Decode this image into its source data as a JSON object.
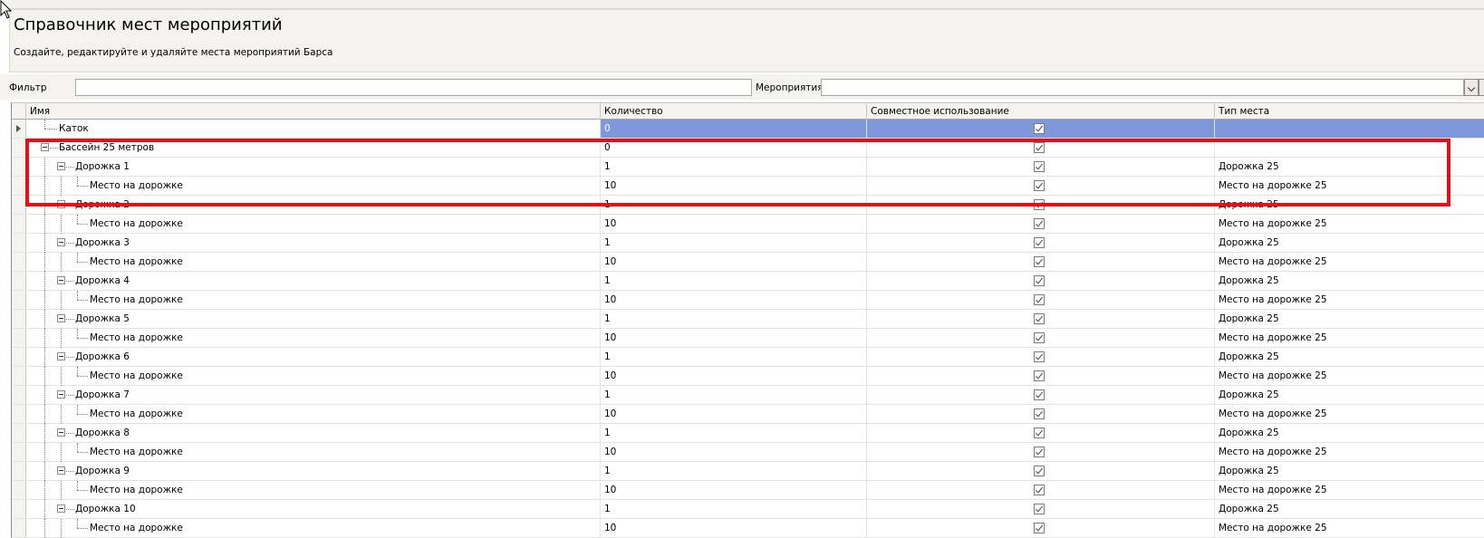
{
  "header": {
    "title": "Справочник мест мероприятий",
    "subtitle": "Создайте, редактируйте и удаляйте места мероприятий Барса"
  },
  "filters": {
    "filter_label": "Фильтр",
    "filter_value": "",
    "events_label": "Мероприятия",
    "events_value": ""
  },
  "grid": {
    "columns": [
      "Имя",
      "Количество",
      "Совместное использование",
      "Тип места"
    ],
    "rows": [
      {
        "name": "Каток",
        "level": 0,
        "expander": false,
        "qty": "0",
        "shared": true,
        "type": "",
        "selected": true
      },
      {
        "name": "Бассейн 25 метров",
        "level": 0,
        "expander": true,
        "qty": "0",
        "shared": true,
        "type": "",
        "selected": false
      },
      {
        "name": "Дорожка 1",
        "level": 1,
        "expander": true,
        "qty": "1",
        "shared": true,
        "type": "Дорожка 25",
        "selected": false
      },
      {
        "name": "Место на дорожке",
        "level": 2,
        "expander": false,
        "qty": "10",
        "shared": true,
        "type": "Место на дорожке 25",
        "selected": false
      },
      {
        "name": "Дорожка 2",
        "level": 1,
        "expander": true,
        "qty": "1",
        "shared": true,
        "type": "Дорожка 25",
        "selected": false
      },
      {
        "name": "Место на дорожке",
        "level": 2,
        "expander": false,
        "qty": "10",
        "shared": true,
        "type": "Место на дорожке 25",
        "selected": false
      },
      {
        "name": "Дорожка 3",
        "level": 1,
        "expander": true,
        "qty": "1",
        "shared": true,
        "type": "Дорожка 25",
        "selected": false
      },
      {
        "name": "Место на дорожке",
        "level": 2,
        "expander": false,
        "qty": "10",
        "shared": true,
        "type": "Место на дорожке 25",
        "selected": false
      },
      {
        "name": "Дорожка 4",
        "level": 1,
        "expander": true,
        "qty": "1",
        "shared": true,
        "type": "Дорожка 25",
        "selected": false
      },
      {
        "name": "Место на дорожке",
        "level": 2,
        "expander": false,
        "qty": "10",
        "shared": true,
        "type": "Место на дорожке 25",
        "selected": false
      },
      {
        "name": "Дорожка 5",
        "level": 1,
        "expander": true,
        "qty": "1",
        "shared": true,
        "type": "Дорожка 25",
        "selected": false
      },
      {
        "name": "Место на дорожке",
        "level": 2,
        "expander": false,
        "qty": "10",
        "shared": true,
        "type": "Место на дорожке 25",
        "selected": false
      },
      {
        "name": "Дорожка 6",
        "level": 1,
        "expander": true,
        "qty": "1",
        "shared": true,
        "type": "Дорожка 25",
        "selected": false
      },
      {
        "name": "Место на дорожке",
        "level": 2,
        "expander": false,
        "qty": "10",
        "shared": true,
        "type": "Место на дорожке 25",
        "selected": false
      },
      {
        "name": "Дорожка 7",
        "level": 1,
        "expander": true,
        "qty": "1",
        "shared": true,
        "type": "Дорожка 25",
        "selected": false
      },
      {
        "name": "Место на дорожке",
        "level": 2,
        "expander": false,
        "qty": "10",
        "shared": true,
        "type": "Место на дорожке 25",
        "selected": false
      },
      {
        "name": "Дорожка 8",
        "level": 1,
        "expander": true,
        "qty": "1",
        "shared": true,
        "type": "Дорожка 25",
        "selected": false
      },
      {
        "name": "Место на дорожке",
        "level": 2,
        "expander": false,
        "qty": "10",
        "shared": true,
        "type": "Место на дорожке 25",
        "selected": false
      },
      {
        "name": "Дорожка 9",
        "level": 1,
        "expander": true,
        "qty": "1",
        "shared": true,
        "type": "Дорожка 25",
        "selected": false
      },
      {
        "name": "Место на дорожке",
        "level": 2,
        "expander": false,
        "qty": "10",
        "shared": true,
        "type": "Место на дорожке 25",
        "selected": false
      },
      {
        "name": "Дорожка 10",
        "level": 1,
        "expander": true,
        "qty": "1",
        "shared": true,
        "type": "Дорожка 25",
        "selected": false
      },
      {
        "name": "Место на дорожке",
        "level": 2,
        "expander": false,
        "qty": "10",
        "shared": true,
        "type": "Место на дорожке 25",
        "selected": false
      }
    ]
  },
  "colors": {
    "selection": "#7f98dc",
    "highlight": "#e3101a",
    "panel": "#f4f3ef"
  }
}
